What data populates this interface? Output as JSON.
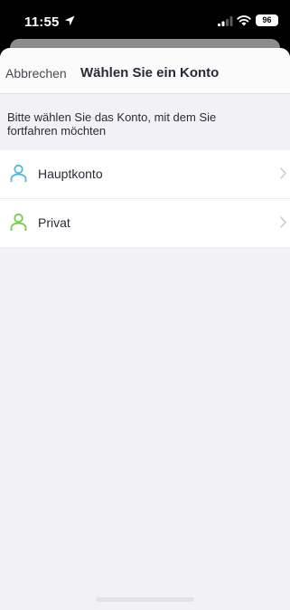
{
  "status_bar": {
    "time": "11:55",
    "battery": "96",
    "icons": [
      "location-arrow-icon",
      "signal-icon",
      "wifi-icon",
      "battery-icon"
    ]
  },
  "nav": {
    "cancel_label": "Abbrechen",
    "title": "Wählen Sie ein Konto"
  },
  "instruction": "Bitte wählen Sie das Konto, mit dem Sie fortfahren möchten",
  "accounts": [
    {
      "label": "Hauptkonto",
      "icon": "user-icon",
      "icon_color": "#4fb6e6"
    },
    {
      "label": "Privat",
      "icon": "user-icon",
      "icon_color": "#6fce3f"
    }
  ],
  "colors": {
    "background": "#f2f2f6",
    "text": "#2b2b38",
    "chevron": "#c7c7cc"
  }
}
